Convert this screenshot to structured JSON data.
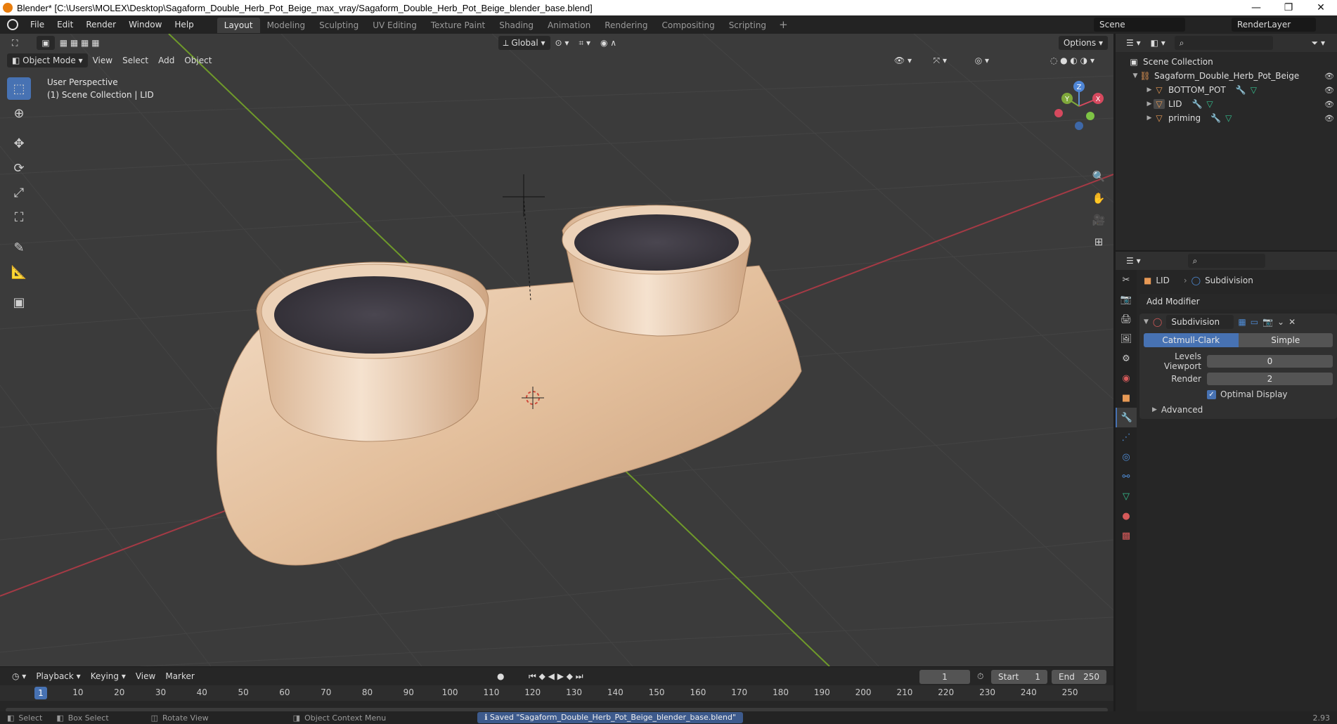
{
  "window": {
    "title": "Blender* [C:\\Users\\MOLEX\\Desktop\\Sagaform_Double_Herb_Pot_Beige_max_vray/Sagaform_Double_Herb_Pot_Beige_blender_base.blend]",
    "min_glyph": "—",
    "restore_glyph": "❐",
    "close_glyph": "✕"
  },
  "menu": {
    "items": [
      "File",
      "Edit",
      "Render",
      "Window",
      "Help"
    ],
    "workspaces": [
      "Layout",
      "Modeling",
      "Sculpting",
      "UV Editing",
      "Texture Paint",
      "Shading",
      "Animation",
      "Rendering",
      "Compositing",
      "Scripting"
    ],
    "active_workspace": "Layout",
    "add_glyph": "+",
    "scene_label": "Scene",
    "render_layer": "RenderLayer"
  },
  "viewport": {
    "mode": "Object Mode",
    "menus": [
      "View",
      "Select",
      "Add",
      "Object"
    ],
    "orientation": "Global",
    "options_label": "Options",
    "info_line1": "User Perspective",
    "info_line2": "(1) Scene Collection | LID",
    "gizmo_axes": {
      "z": "Z",
      "y": "Y",
      "x": "X"
    },
    "colors": {
      "background": "#3b3b3b",
      "grid": "#444444",
      "x_axis": "#a53a45",
      "y_axis": "#6f9a2a",
      "object": "#e6c3a2",
      "soil": "#3a363c"
    }
  },
  "toolbar": {
    "tools": [
      "select-box-icon",
      "cursor-icon",
      "move-icon",
      "rotate-icon",
      "scale-icon",
      "transform-icon",
      "annotate-icon",
      "measure-icon",
      "add-cube-icon"
    ]
  },
  "timeline": {
    "menus": [
      "Playback",
      "Keying",
      "View",
      "Marker"
    ],
    "current_frame": "1",
    "start_label": "Start",
    "start_value": "1",
    "end_label": "End",
    "end_value": "250",
    "ticks": [
      "10",
      "20",
      "30",
      "40",
      "50",
      "60",
      "70",
      "80",
      "90",
      "100",
      "110",
      "120",
      "130",
      "140",
      "150",
      "160",
      "170",
      "180",
      "190",
      "200",
      "210",
      "220",
      "230",
      "240",
      "250"
    ],
    "marker_label": "1"
  },
  "statusbar": {
    "select": "Select",
    "box_select": "Box Select",
    "rotate_view": "Rotate View",
    "context_menu": "Object Context Menu",
    "notification": "Saved \"Sagaform_Double_Herb_Pot_Beige_blender_base.blend\"",
    "version": "2.93"
  },
  "outliner": {
    "root": "Scene Collection",
    "collection": "Sagaform_Double_Herb_Pot_Beige",
    "objects": [
      "BOTTOM_POT",
      "LID",
      "priming"
    ]
  },
  "properties": {
    "object_name": "LID",
    "modifier_name_header": "Subdivision",
    "add_modifier": "Add Modifier",
    "modifier": {
      "name": "Subdivision",
      "type_options": [
        "Catmull-Clark",
        "Simple"
      ],
      "active_type": "Catmull-Clark",
      "levels_viewport_label": "Levels Viewport",
      "levels_viewport_value": "0",
      "render_label": "Render",
      "render_value": "2",
      "optimal_display_label": "Optimal Display",
      "optimal_display_checked": true,
      "advanced_label": "Advanced"
    }
  }
}
